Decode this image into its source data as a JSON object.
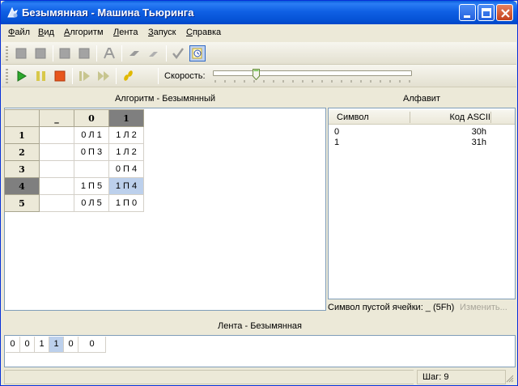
{
  "window": {
    "title": "Безымянная - Машина Тьюринга"
  },
  "menu": {
    "items": [
      "Файл",
      "Вид",
      "Алгоритм",
      "Лента",
      "Запуск",
      "Справка"
    ],
    "accel": [
      "Ф",
      "В",
      "А",
      "Л",
      "З",
      "С"
    ],
    "rest": [
      "айл",
      "ид",
      "лгоритм",
      "ента",
      "апуск",
      "правка"
    ]
  },
  "toolbar": {
    "speed_label": "Скорость:",
    "speed_level": 0.2
  },
  "algorithm": {
    "title": "Алгоритм - Безымянный",
    "columns": [
      "_",
      "0",
      "1"
    ],
    "selected_column": 2,
    "rows": [
      {
        "state": "1",
        "cells": [
          "",
          "0 Л 1",
          "1 Л 2"
        ]
      },
      {
        "state": "2",
        "cells": [
          "",
          "0 П 3",
          "1 Л 2"
        ]
      },
      {
        "state": "3",
        "cells": [
          "",
          "",
          "0 П 4"
        ]
      },
      {
        "state": "4",
        "cells": [
          "",
          "1 П 5",
          "1 П 4"
        ]
      },
      {
        "state": "5",
        "cells": [
          "",
          "0 Л 5",
          "1 П 0"
        ]
      }
    ],
    "selected_row": 3
  },
  "alphabet": {
    "title": "Алфавит",
    "col_symbol": "Символ",
    "col_code": "Код ASCII",
    "rows": [
      {
        "symbol": "0",
        "code": "30h"
      },
      {
        "symbol": "1",
        "code": "31h"
      }
    ],
    "empty_cell_label": "Символ пустой ячейки: _ (5Fh)",
    "change_link": "Изменить..."
  },
  "tape": {
    "title": "Лента - Безымянная",
    "cells": [
      "0",
      "0",
      "1",
      "1",
      "0",
      "0"
    ],
    "head_index": 3
  },
  "status": {
    "step": "Шаг: 9"
  }
}
